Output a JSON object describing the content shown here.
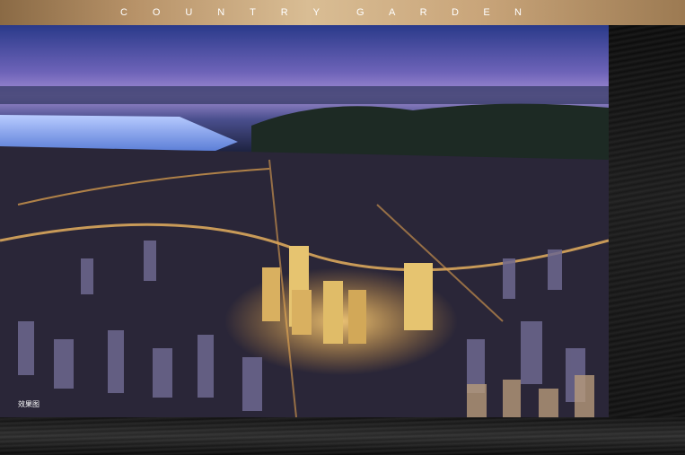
{
  "header": {
    "brand_word_1": [
      "C",
      "O",
      "U",
      "N",
      "T",
      "R",
      "Y"
    ],
    "brand_word_2": [
      "G",
      "A",
      "R",
      "D",
      "E",
      "N"
    ]
  },
  "image": {
    "caption": "效果图"
  },
  "colors": {
    "gold_bar": "#c9a57a",
    "background": "#050505"
  }
}
